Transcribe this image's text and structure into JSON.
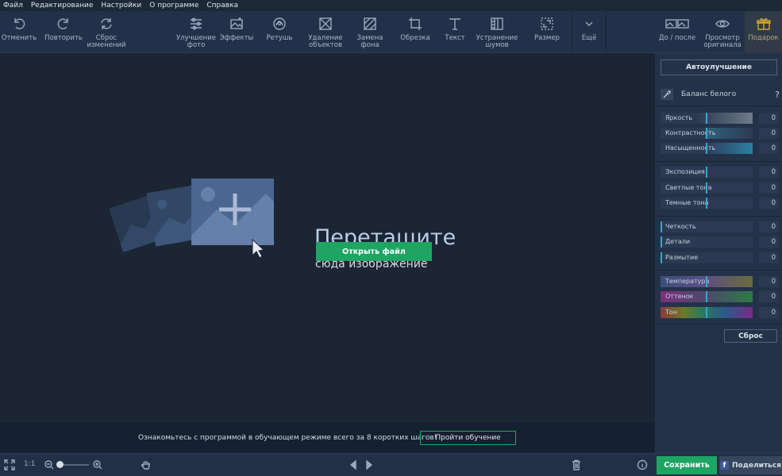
{
  "menu": [
    "Файл",
    "Редактирование",
    "Настройки",
    "О программе",
    "Справка"
  ],
  "toolbar": {
    "undo": "Отменить",
    "redo": "Повторить",
    "reset_changes": "Сброс\nизменений",
    "enhance": "Улучшение\nфото",
    "effects": "Эффекты",
    "retouch": "Ретушь",
    "remove_objects": "Удаление\nобъектов",
    "replace_bg": "Замена\nфона",
    "crop": "Обрезка",
    "text": "Текст",
    "denoise": "Устранение\nшумов",
    "resize": "Размер",
    "more": "Ещё",
    "before_after": "До / после",
    "view_original": "Просмотр\nоригинала",
    "gift": "Подарок"
  },
  "canvas": {
    "title": "Перетащите",
    "subtitle": "сюда изображение",
    "open_button": "Открыть файл"
  },
  "tutorial": {
    "text": "Ознакомьтесь с программой в обучающем режиме всего за 8 коротких шагов!",
    "button": "Пройти обучение"
  },
  "statusbar": {
    "one_to_one": "1:1",
    "zoom_fraction": 0.0,
    "save": "Сохранить",
    "share": "Поделиться"
  },
  "panel": {
    "auto_enhance": "Автоулучшение",
    "white_balance": "Баланс белого",
    "help": "?",
    "reset": "Сброс",
    "sliders": [
      {
        "name": "Яркость",
        "value": "0"
      },
      {
        "name": "Контрастность",
        "value": "0"
      },
      {
        "name": "Насыщенность",
        "value": "0"
      },
      {
        "name": "Экспозиция",
        "value": "0"
      },
      {
        "name": "Светлые тона",
        "value": "0"
      },
      {
        "name": "Темные тона",
        "value": "0"
      },
      {
        "name": "Четкость",
        "value": "0"
      },
      {
        "name": "Детали",
        "value": "0"
      },
      {
        "name": "Размытие",
        "value": "0"
      },
      {
        "name": "Температура",
        "value": "0"
      },
      {
        "name": "Оттенок",
        "value": "0"
      },
      {
        "name": "Тон",
        "value": "0"
      }
    ]
  },
  "colors": {
    "accent_green": "#1ea463",
    "slider_mark": "#31a9d6",
    "gift": "#d8a63a"
  }
}
